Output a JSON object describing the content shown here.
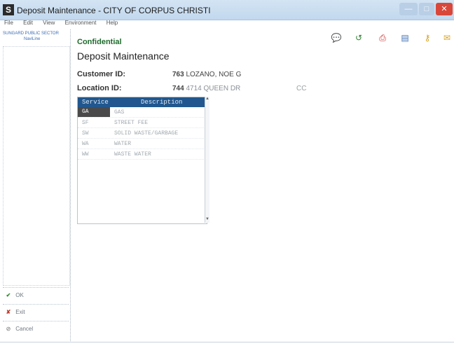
{
  "window": {
    "title": "Deposit Maintenance - CITY OF CORPUS CHRISTI",
    "app_icon_letter": "S"
  },
  "menu": [
    "File",
    "Edit",
    "View",
    "Environment",
    "Help"
  ],
  "sidebar": {
    "brand": "SUNGARD PUBLIC SECTOR",
    "brand_sub": "NaviLine",
    "buttons": [
      {
        "label": "OK",
        "icon": "check-icon",
        "color": "#2e8b2e"
      },
      {
        "label": "Exit",
        "icon": "x-icon",
        "color": "#c0392b"
      },
      {
        "label": "Cancel",
        "icon": "cancel-icon",
        "color": "#999999"
      }
    ]
  },
  "toolbar_icons": [
    {
      "name": "chat-icon",
      "glyph": "💬",
      "color": "#8a8a8a"
    },
    {
      "name": "refresh-icon",
      "glyph": "↺",
      "color": "#2e7d32"
    },
    {
      "name": "print-icon",
      "glyph": "⎙",
      "color": "#c62828"
    },
    {
      "name": "document-icon",
      "glyph": "▤",
      "color": "#3f6fb5"
    },
    {
      "name": "key-icon",
      "glyph": "⚷",
      "color": "#d4a017"
    },
    {
      "name": "mail-icon",
      "glyph": "✉",
      "color": "#d9a520"
    }
  ],
  "main": {
    "confidential": "Confidential",
    "title": "Deposit Maintenance",
    "customer_label": "Customer ID:",
    "customer_id": "763",
    "customer_name": "LOZANO, NOE G",
    "location_label": "Location ID:",
    "location_id": "744",
    "location_address": "4714 QUEEN DR",
    "location_code": "CC"
  },
  "grid": {
    "headers": [
      "Service",
      "Description"
    ],
    "rows": [
      {
        "service": "GA",
        "description": "GAS"
      },
      {
        "service": "SF",
        "description": "STREET FEE"
      },
      {
        "service": "SW",
        "description": "SOLID WASTE/GARBAGE"
      },
      {
        "service": "WA",
        "description": "WATER"
      },
      {
        "service": "WW",
        "description": "WASTE WATER"
      }
    ]
  }
}
